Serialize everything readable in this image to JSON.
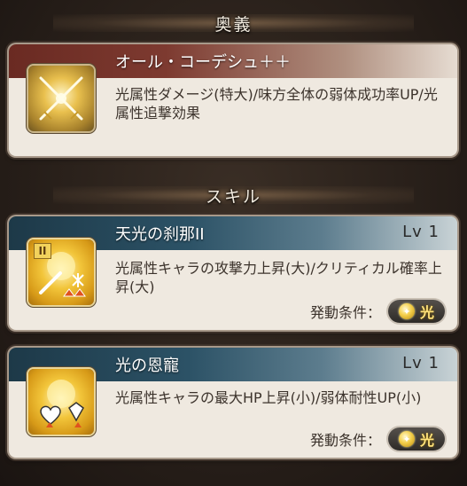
{
  "sections": {
    "ougi_title": "奥義",
    "skill_title": "スキル"
  },
  "ougi": {
    "name": "オール・コーデシュ＋＋",
    "description": "光属性ダメージ(特大)/味方全体の弱体成功率UP/光属性追撃効果",
    "icon": "crossed-swords-icon"
  },
  "skills": [
    {
      "name": "天光の刹那II",
      "level": "Lv 1",
      "description": "光属性キャラの攻撃力上昇(大)/クリティカル確率上昇(大)",
      "roman": "II",
      "condition_label": "発動条件：",
      "condition_element": "光",
      "icon": "sword-attack-up-icon"
    },
    {
      "name": "光の恩寵",
      "level": "Lv 1",
      "description": "光属性キャラの最大HP上昇(小)/弱体耐性UP(小)",
      "condition_label": "発動条件：",
      "condition_element": "光",
      "icon": "heart-shield-icon"
    }
  ],
  "colors": {
    "ougi_titlebar": "#6a2a22",
    "skill_titlebar": "#1d3948",
    "light_element": "#f4cf4a"
  }
}
